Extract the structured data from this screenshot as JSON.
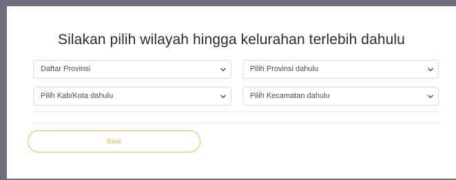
{
  "dialog": {
    "title": "Silakan pilih wilayah hingga kelurahan terlebih dahulu"
  },
  "selects": [
    {
      "value": "Daftar Provinsi",
      "icon": "chevron-down-icon"
    },
    {
      "value": "Pilih Provinsi dahulu",
      "icon": "chevron-down-icon"
    },
    {
      "value": "Pilih Kab/Kota dahulu",
      "icon": "chevron-down-icon"
    },
    {
      "value": "Pilih Kecamatan dahulu",
      "icon": "chevron-down-icon"
    }
  ],
  "actions": {
    "cancel_label": "Batal"
  },
  "colors": {
    "backdrop": "#6d6f7d",
    "accent": "#f2b94b",
    "border": "#d9dce0"
  }
}
